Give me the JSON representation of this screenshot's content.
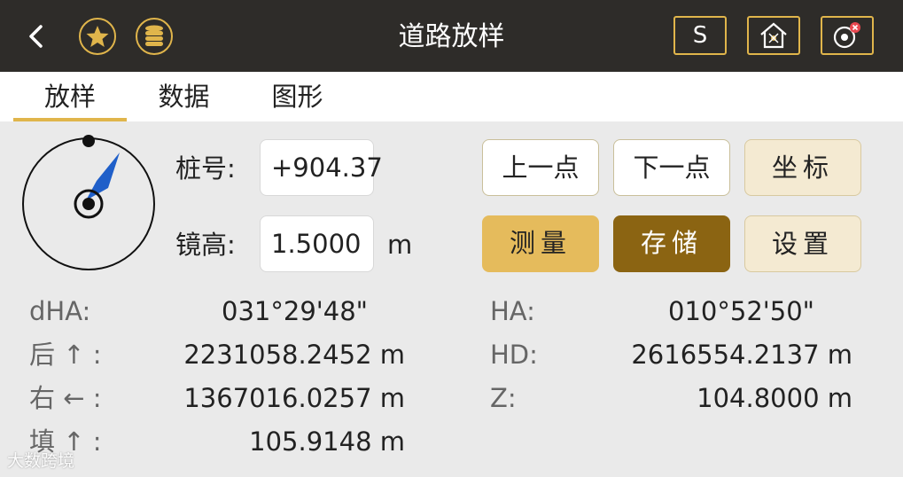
{
  "header": {
    "back_glyph": "<",
    "title": "道路放样",
    "s_label": "S"
  },
  "tabs": [
    {
      "label": "放样",
      "active": true
    },
    {
      "label": "数据",
      "active": false
    },
    {
      "label": "图形",
      "active": false
    }
  ],
  "form": {
    "station_label": "桩号:",
    "station_value": "+904.37",
    "pole_label": "镜高:",
    "pole_value": "1.5000",
    "pole_unit": "m"
  },
  "buttons": {
    "prev": "上一点",
    "next": "下一点",
    "coord": "坐标",
    "measure": "测量",
    "save": "存储",
    "settings": "设置"
  },
  "readings": {
    "dha_label": "dHA:",
    "dha_value": "031°29'48\"",
    "ha_label": "HA:",
    "ha_value": "010°52'50\"",
    "back_label": "后 ↑ :",
    "back_value": "2231058.2452  m",
    "hd_label": "HD:",
    "hd_value": "2616554.2137  m",
    "right_label": "右 ← :",
    "right_value": "1367016.0257  m",
    "z_label": "Z:",
    "z_value": "104.8000  m",
    "fill_label": "填 ↑ :",
    "fill_value": "105.9148  m"
  },
  "watermark": "大数跨境",
  "colors": {
    "titlebar": "#2e2c29",
    "accent": "#e0b54b",
    "arrow": "#1f5fc9",
    "measure_btn": "#e5bb5c",
    "save_btn": "#8b6412"
  }
}
